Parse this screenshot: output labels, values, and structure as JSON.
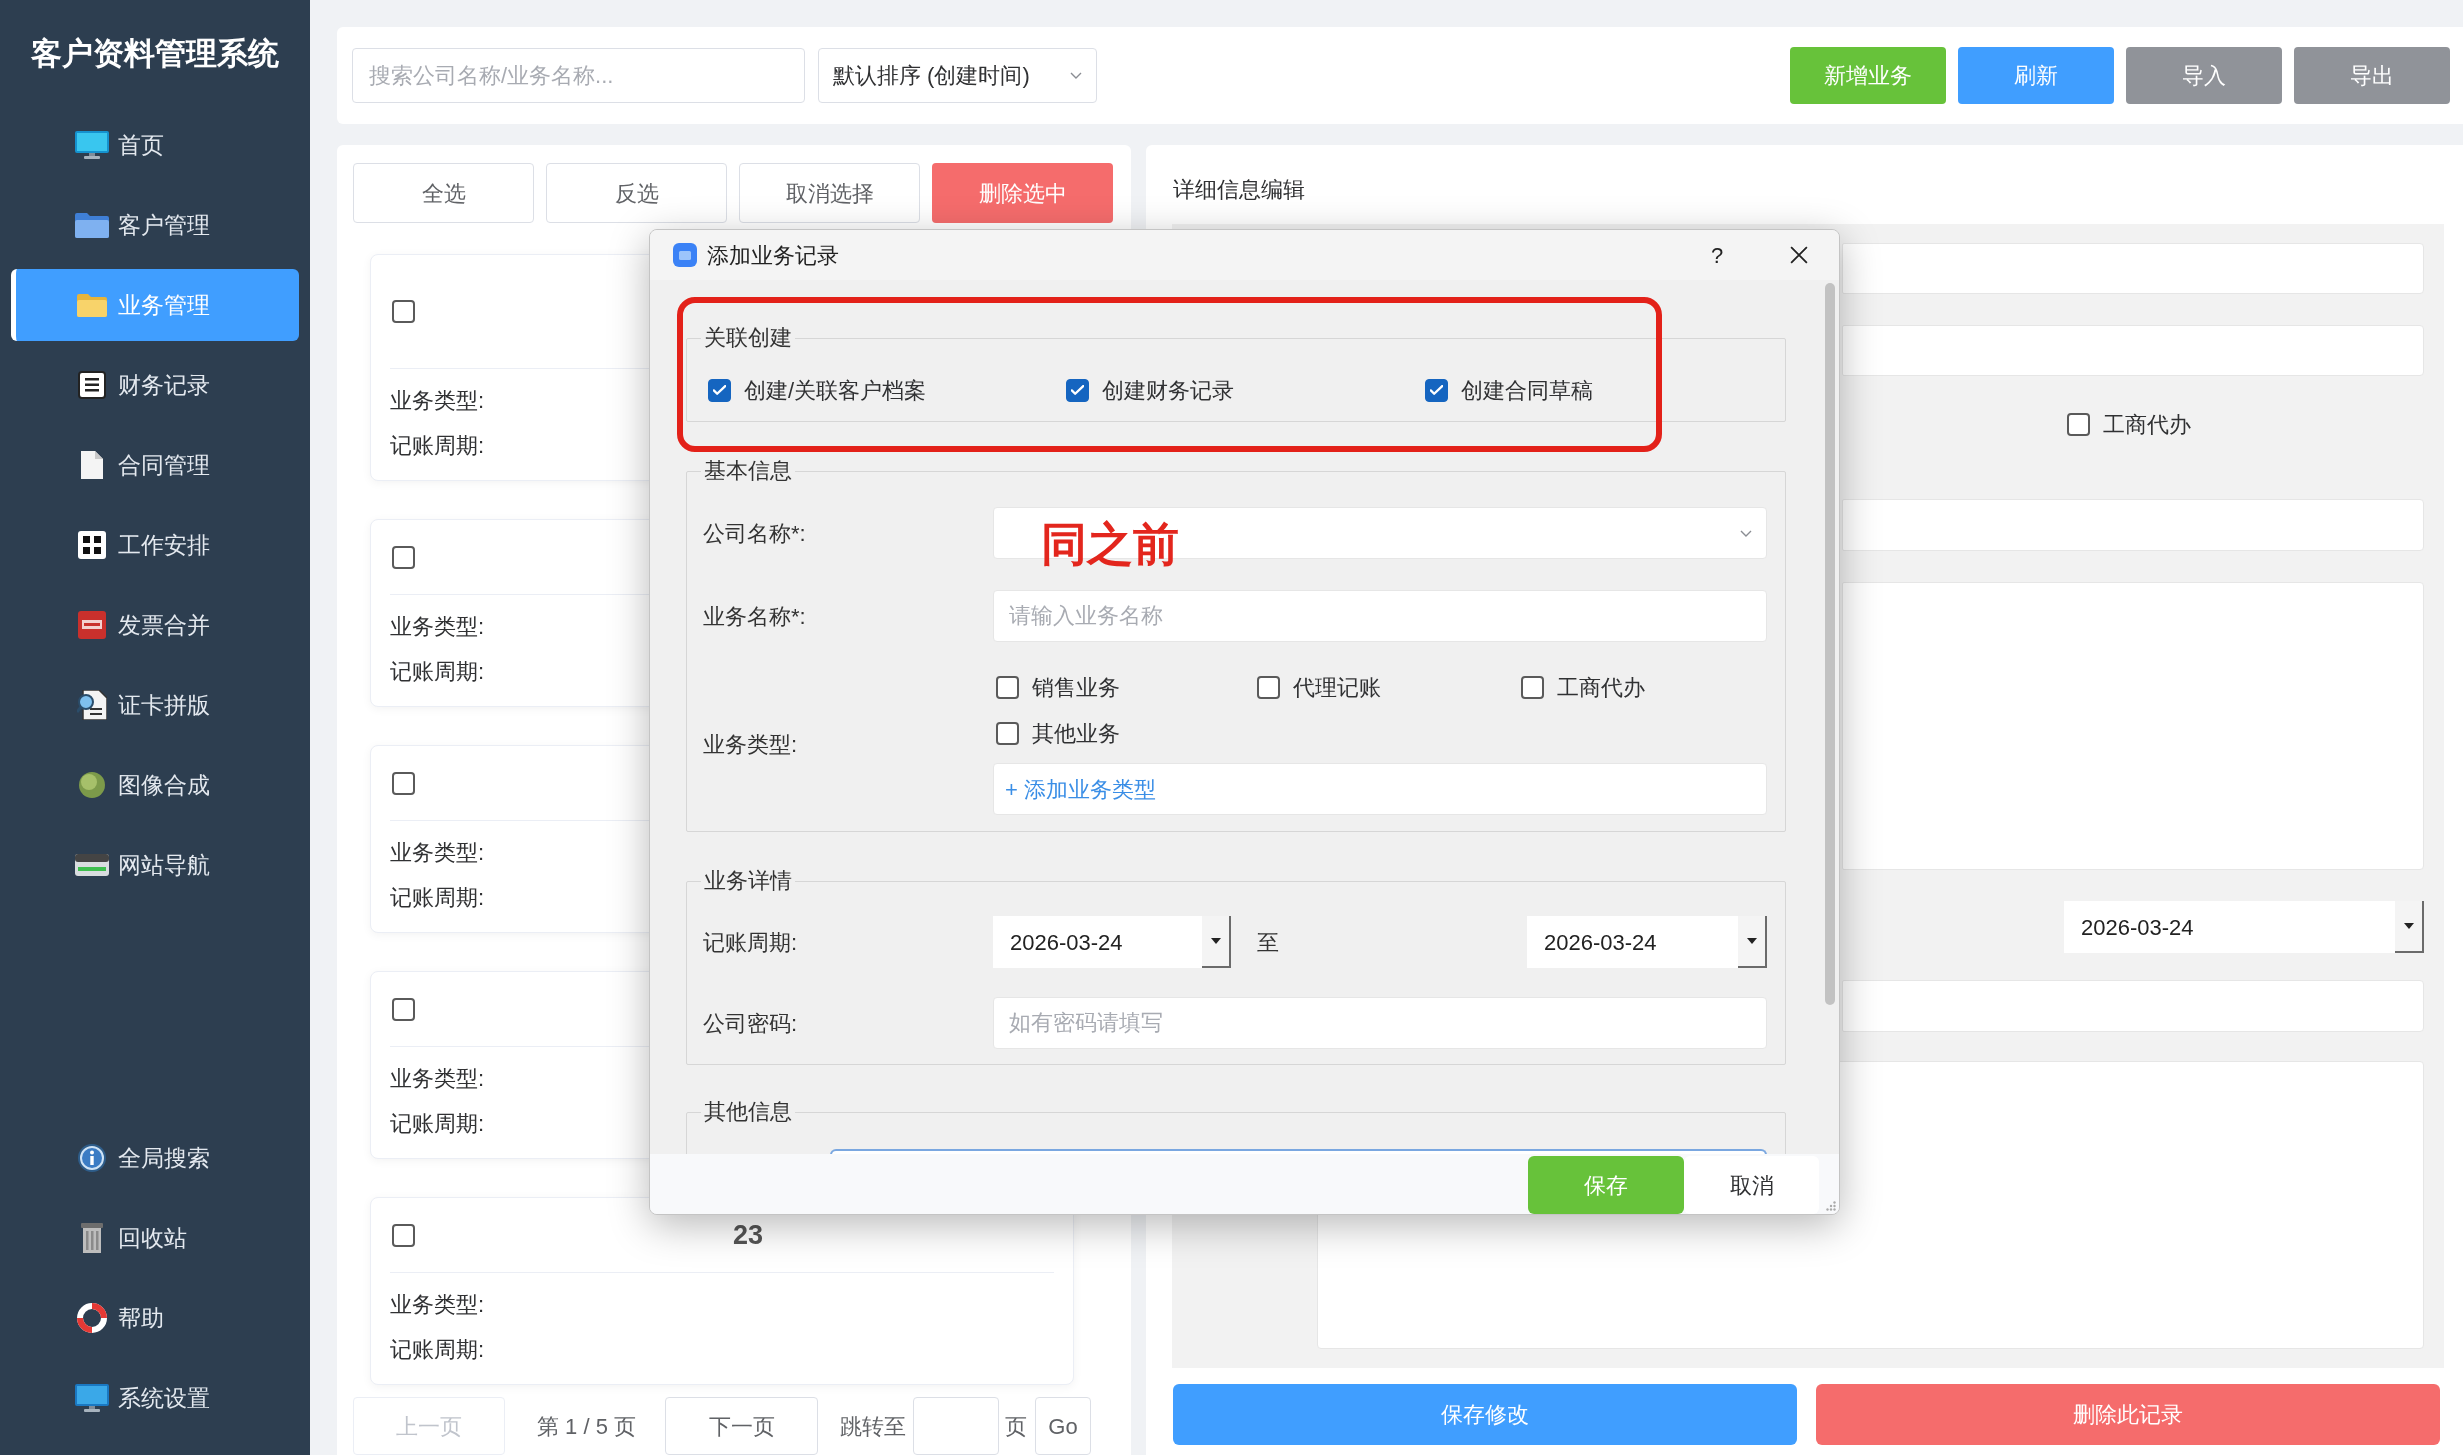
{
  "sidebar": {
    "title": "客户资料管理系统",
    "items": [
      {
        "label": "首页",
        "selected": false
      },
      {
        "label": "客户管理",
        "selected": false
      },
      {
        "label": "业务管理",
        "selected": true
      },
      {
        "label": "财务记录",
        "selected": false
      },
      {
        "label": "合同管理",
        "selected": false
      },
      {
        "label": "工作安排",
        "selected": false
      },
      {
        "label": "发票合并",
        "selected": false
      },
      {
        "label": "证卡拼版",
        "selected": false
      },
      {
        "label": "图像合成",
        "selected": false
      },
      {
        "label": "网站导航",
        "selected": false
      }
    ],
    "bottom_items": [
      {
        "label": "全局搜索",
        "selected": false
      },
      {
        "label": "回收站",
        "selected": false
      },
      {
        "label": "帮助",
        "selected": false
      },
      {
        "label": "系统设置",
        "selected": false
      }
    ]
  },
  "toolbar": {
    "search": {
      "placeholder": "搜索公司名称/业务名称..."
    },
    "sort": {
      "value": "默认排序 (创建时间)"
    },
    "buttons": [
      {
        "label": "新增业务",
        "kind": "success"
      },
      {
        "label": "刷新",
        "kind": "primary"
      },
      {
        "label": "导入",
        "kind": "neutral"
      },
      {
        "label": "导出",
        "kind": "neutral"
      }
    ]
  },
  "list_panel": {
    "actions": [
      {
        "label": "全选",
        "kind": "default"
      },
      {
        "label": "反选",
        "kind": "default"
      },
      {
        "label": "取消选择",
        "kind": "default"
      },
      {
        "label": "删除选中",
        "kind": "danger"
      }
    ],
    "cards": [
      {
        "checked": false,
        "fields": [
          "业务类型:",
          "记账周期:"
        ]
      },
      {
        "checked": false,
        "fields": [
          "业务类型:",
          "记账周期:"
        ]
      },
      {
        "checked": false,
        "fields": [
          "业务类型:",
          "记账周期:"
        ]
      },
      {
        "checked": false,
        "fields": [
          "业务类型:",
          "记账周期:"
        ]
      },
      {
        "title": "23",
        "checked": false,
        "fields": [
          "业务类型:",
          "记账周期:"
        ]
      }
    ],
    "pagination": {
      "prev": {
        "label": "上一页",
        "disabled": true
      },
      "page_info": "第 1 / 5 页",
      "next": {
        "label": "下一页",
        "disabled": false
      },
      "jump_label": "跳转至",
      "page_unit": "页",
      "go": "Go"
    }
  },
  "detail_panel": {
    "title": "详细信息编辑",
    "checkbox": {
      "label": "工商代办",
      "checked": false
    },
    "date": "2026-03-24",
    "buttons": [
      {
        "label": "保存修改",
        "kind": "primary"
      },
      {
        "label": "删除此记录",
        "kind": "danger"
      }
    ]
  },
  "dialog": {
    "title": "添加业务记录",
    "help": "?",
    "linked_create": {
      "legend": "关联创建",
      "options": [
        {
          "label": "创建/关联客户档案",
          "checked": true
        },
        {
          "label": "创建财务记录",
          "checked": true
        },
        {
          "label": "创建合同草稿",
          "checked": true
        }
      ]
    },
    "basic_info": {
      "legend": "基本信息",
      "company": {
        "label": "公司名称*:"
      },
      "business_name": {
        "label": "业务名称*:",
        "placeholder": "请输入业务名称"
      },
      "business_type": {
        "label": "业务类型:",
        "options": [
          {
            "label": "销售业务",
            "checked": false
          },
          {
            "label": "代理记账",
            "checked": false
          },
          {
            "label": "工商代办",
            "checked": false
          },
          {
            "label": "其他业务",
            "checked": false
          }
        ],
        "add_link": "+ 添加业务类型"
      }
    },
    "details": {
      "legend": "业务详情",
      "period": {
        "label": "记账周期:",
        "from": "2026-03-24",
        "separator": "至",
        "to": "2026-03-24"
      },
      "password": {
        "label": "公司密码:",
        "placeholder": "如有密码请填写"
      }
    },
    "other_info": {
      "legend": "其他信息"
    },
    "buttons": [
      {
        "label": "保存",
        "kind": "success"
      },
      {
        "label": "取消",
        "kind": "plain"
      }
    ]
  },
  "annotation": {
    "text": "同之前"
  }
}
